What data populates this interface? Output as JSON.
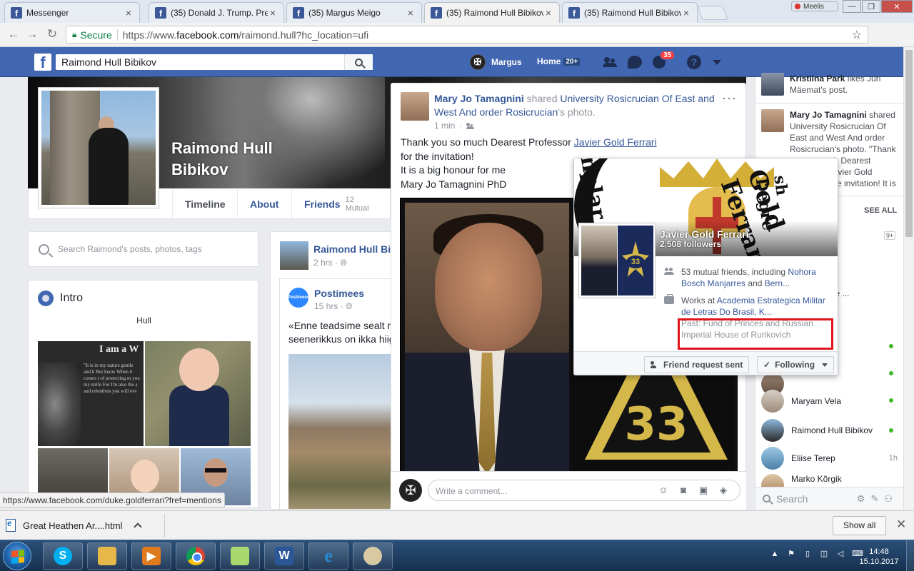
{
  "browser": {
    "tabs": [
      {
        "title": "Messenger",
        "active": false
      },
      {
        "title": "(35) Donald J. Trump. Pre",
        "active": false
      },
      {
        "title": "(35) Margus Meigo",
        "active": false
      },
      {
        "title": "(35) Raimond Hull Bibikov",
        "active": true
      },
      {
        "title": "(35) Raimond Hull Bibikov",
        "active": false
      }
    ],
    "profile_name": "Meelis",
    "secure_label": "Secure",
    "url_scheme": "https://www.",
    "url_domain": "facebook.com",
    "url_path": "/raimond.hull?hc_location=ufi",
    "status_url": "https://www.facebook.com/duke.goldferrari?fref=mentions",
    "window_controls": {
      "minimize": "—",
      "maximize": "❐",
      "close": "✕"
    }
  },
  "fb_header": {
    "search_value": "Raimond Hull Bibikov",
    "user_name": "Margus",
    "home_label": "Home",
    "home_count": "20+",
    "notification_count": "35"
  },
  "profile": {
    "name": "Raimond Hull Bibikov",
    "tabs": [
      {
        "label": "Timeline"
      },
      {
        "label": "About"
      },
      {
        "label": "Friends",
        "mutual": "12 Mutual"
      }
    ],
    "search_placeholder": "Search Raimond's posts, photos, tags",
    "intro_title": "Intro",
    "intro_text": "Hull",
    "wolf_title": "I am a W",
    "wolf_lines": "\"It is in my nature gentle and k But know When it comes t of protecting m you my strife For I'm also the a and relentless you will eve"
  },
  "timeline_post": {
    "author": "Raimond Hull Bi",
    "time": "2 hrs",
    "page_name": "Postimees",
    "page_avatar_text": "Postimees",
    "page_time": "15 hrs",
    "text_line1": "«Enne teadsime sealt m",
    "text_line2": "seenerikkus on ikka hiig"
  },
  "shared_post": {
    "author": "Mary Jo Tamagnini",
    "verb": " shared ",
    "shared_from": "University Rosicrucian Of East and West And order Rosicrucian",
    "suffix": "'s photo.",
    "time": "1 min",
    "body_prefix": "Thank you so much Dearest Professor ",
    "mention": "Javier Gold Ferrari",
    "body_line2": "for the invitation!",
    "body_line3": "It is a big honour for me",
    "body_line4": "Mary Jo Tamagnini PhD",
    "emblem_number": "33",
    "comment_placeholder": "Write a comment..."
  },
  "hovercard": {
    "name": "Javier Gold Ferrari",
    "followers": "2,508 followers",
    "mutual_prefix": "53 mutual friends, including ",
    "mutual_names": "Nohora Bosch Manjarres",
    "mutual_and": " and ",
    "mutual_more": "Bern...",
    "works_prefix": "Works at ",
    "works_at": "Academia Estrategica Militar de Letras Do Brasil, K...",
    "past": "Past: Fund of Princes and Russian Imperial House of Rurikovich",
    "badge_number": "33",
    "friend_request_label": "Friend request sent",
    "following_label": "Following",
    "cover_text_a": "Gold Ferrari",
    "cover_text_b": "nplar Pr",
    "cover_text_c": "sh Degre"
  },
  "sidebar": {
    "ticker": [
      {
        "name": "Kristiina Park",
        "text": " likes Jüri Mäemat's post."
      },
      {
        "name": "Mary Jo Tamagnini",
        "text": " shared University Rosicrucian Of East and West And order Rosicrucian's photo. \"Thank you so much Dearest Professor Javier Gold Ferrari for the invitation! It is a big honour for me Mary Jo Tamagnini PhD\""
      }
    ],
    "see_all": "SEE ALL",
    "count_badge": "9+",
    "partial_contact": "s Meigo ( life ...",
    "contacts": [
      {
        "name": "Maryam Vela",
        "status": ""
      },
      {
        "name": "Raimond Hull Bibikov",
        "status": ""
      },
      {
        "name": "Eliise Terep",
        "status": "1h"
      },
      {
        "name": "Marko Kõrgik",
        "status": ""
      }
    ],
    "search_placeholder": "Search"
  },
  "download": {
    "file_name": "Great Heathen Ar....html",
    "show_all": "Show all"
  },
  "taskbar": {
    "time": "14:48",
    "date": "15.10.2017"
  }
}
